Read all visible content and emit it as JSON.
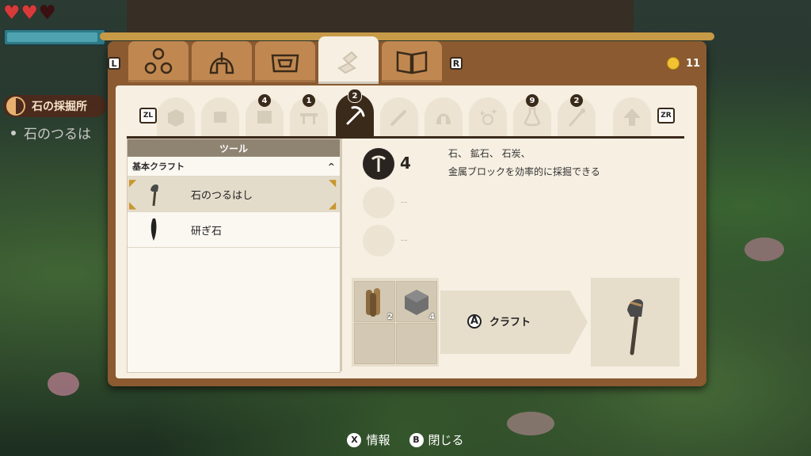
{
  "hud": {
    "hearts": [
      "full",
      "full",
      "empty"
    ],
    "stamina_fraction": 0.95,
    "quest_title": "石の採掘所",
    "quest_item": "石のつるは"
  },
  "menu": {
    "left_shoulder": "L",
    "right_shoulder": "R",
    "coins": "11",
    "top_tabs": [
      {
        "icon": "materials-icon"
      },
      {
        "icon": "helmet-icon"
      },
      {
        "icon": "bag-icon"
      },
      {
        "icon": "crafting-icon",
        "active": true
      },
      {
        "icon": "book-icon"
      }
    ],
    "left_trigger": "ZL",
    "right_trigger": "ZR",
    "category_tabs": [
      {
        "icon": "block-icon",
        "badge": ""
      },
      {
        "icon": "material-icon",
        "badge": ""
      },
      {
        "icon": "furniture-icon",
        "badge": "4"
      },
      {
        "icon": "table-icon",
        "badge": "1"
      },
      {
        "icon": "pickaxe-icon",
        "badge": "2",
        "active": true
      },
      {
        "icon": "sword-icon",
        "badge": ""
      },
      {
        "icon": "armor-icon",
        "badge": ""
      },
      {
        "icon": "sparkle-icon",
        "badge": ""
      },
      {
        "icon": "potion-icon",
        "badge": "9"
      },
      {
        "icon": "wand-icon",
        "badge": "2"
      },
      {
        "icon": "upgrade-icon",
        "badge": ""
      }
    ],
    "list": {
      "header": "ツール",
      "group": "基本クラフト",
      "items": [
        {
          "label": "石のつるはし",
          "selected": true
        },
        {
          "label": "研ぎ石",
          "selected": false
        }
      ]
    },
    "detail": {
      "level": "4",
      "empty_dash": "--",
      "description_line1": "石、 鉱石、 石炭、",
      "description_line2": "金属ブロックを効率的に採掘できる",
      "ingredients": [
        {
          "icon": "wood-icon",
          "count": "2"
        },
        {
          "icon": "stone-block-icon",
          "count": "4"
        }
      ],
      "craft_button_key": "A",
      "craft_label": "クラフト"
    }
  },
  "prompts": [
    {
      "key": "X",
      "label": "情報"
    },
    {
      "key": "B",
      "label": "閉じる"
    }
  ]
}
